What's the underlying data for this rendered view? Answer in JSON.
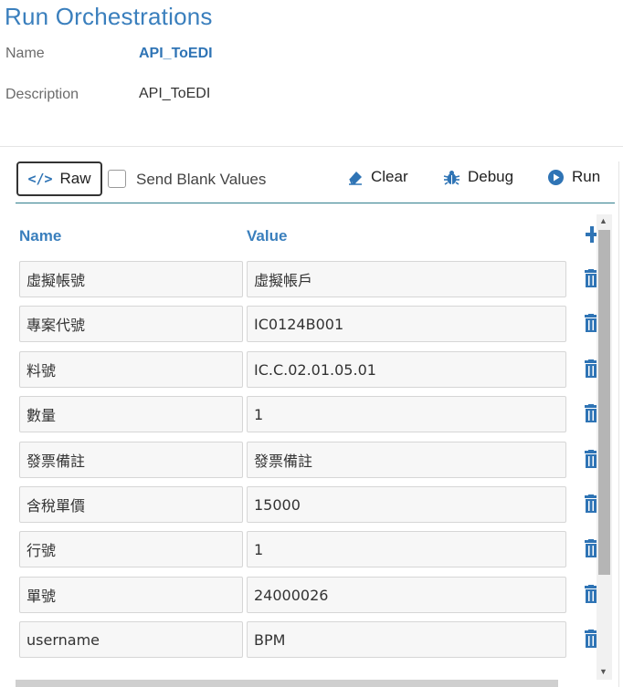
{
  "page": {
    "title": "Run Orchestrations",
    "name_label": "Name",
    "name_value": "API_ToEDI",
    "description_label": "Description",
    "description_value": "API_ToEDI"
  },
  "toolbar": {
    "raw_label": "Raw",
    "raw_icon": "code-icon",
    "send_blank_label": "Send Blank Values",
    "send_blank_checked": false,
    "clear_label": "Clear",
    "debug_label": "Debug",
    "run_label": "Run"
  },
  "table": {
    "name_header": "Name",
    "value_header": "Value",
    "rows": [
      {
        "name": "虛擬帳號",
        "value": "虛擬帳戶"
      },
      {
        "name": "專案代號",
        "value": "IC0124B001"
      },
      {
        "name": "料號",
        "value": "IC.C.02.01.05.01"
      },
      {
        "name": "數量",
        "value": "1"
      },
      {
        "name": "發票備註",
        "value": "發票備註"
      },
      {
        "name": "含稅單價",
        "value": "15000"
      },
      {
        "name": "行號",
        "value": "1"
      },
      {
        "name": "單號",
        "value": "24000026"
      },
      {
        "name": "username",
        "value": "BPM"
      }
    ]
  },
  "colors": {
    "accent": "#3a7fbd",
    "link_bold": "#2f74b5",
    "toolbar_underline": "#2f7d8c"
  }
}
